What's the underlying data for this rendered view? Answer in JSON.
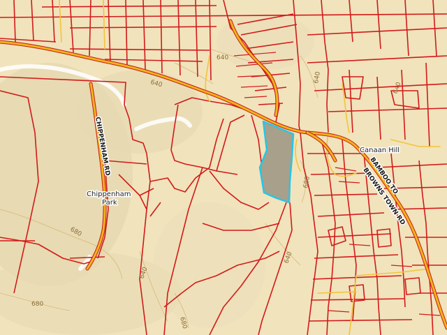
{
  "labels": {
    "chippenham_rd": "CHIPPENHAM RD",
    "chippenham_park_line1": "Chippenham",
    "chippenham_park_line2": "Park",
    "canaan_hill": "Canaan Hill",
    "bamboo_to": "BAMBOO TO",
    "browns_town_rd": "BROWNS TOWN RD"
  },
  "contours": {
    "c1": "640",
    "c2": "640",
    "c3": "640",
    "c4": "680",
    "c5": "680",
    "c6": "640",
    "c7": "680",
    "c8": "640",
    "c9": "680",
    "c10": "640"
  },
  "colors": {
    "background": "#f1e3bc",
    "parcel_boundary": "#d11a1a",
    "main_road": "#f3b31b",
    "selected_parcel_fill": "#a8a08a",
    "selected_parcel_outline": "#26c6e8"
  }
}
